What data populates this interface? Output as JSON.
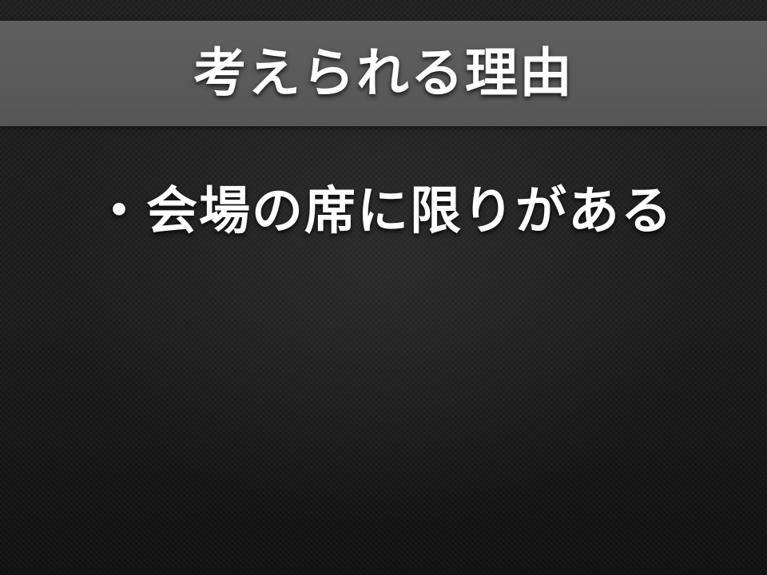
{
  "slide": {
    "title": "考えられる理由",
    "bullets": [
      {
        "text": "・会場の席に限りがある"
      }
    ]
  },
  "colors": {
    "background": "#1c1c1c",
    "title_band": "#5a5a5a",
    "text": "#ffffff"
  }
}
